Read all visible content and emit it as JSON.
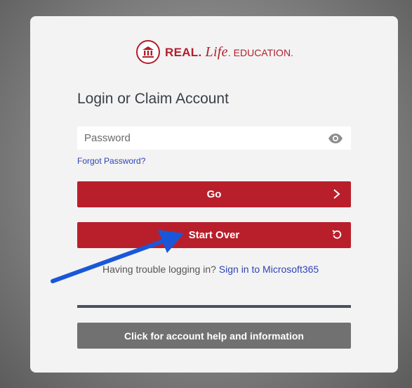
{
  "brand": {
    "part1": "REAL.",
    "part2": "Life",
    "part3": ". EDUCATION.",
    "seal_icon": "college-seal-icon",
    "color": "#b21e2b"
  },
  "login": {
    "title": "Login or Claim Account",
    "password_placeholder": "Password",
    "password_value": "",
    "forgot_label": "Forgot Password?"
  },
  "buttons": {
    "go_label": "Go",
    "go_icon": "chevron-right-icon",
    "start_over_label": "Start Over",
    "start_over_icon": "refresh-icon",
    "help_label": "Click for account help and information"
  },
  "help": {
    "trouble_text": "Having trouble logging in?",
    "ms_link_label": "Sign in to Microsoft365"
  },
  "annotation": {
    "icon": "arrow-pointer-icon",
    "color": "#1a57d8"
  },
  "colors": {
    "primary_red": "#b91f2b",
    "link_blue": "#2f44b5",
    "help_gray": "#717171",
    "divider": "#475260"
  }
}
